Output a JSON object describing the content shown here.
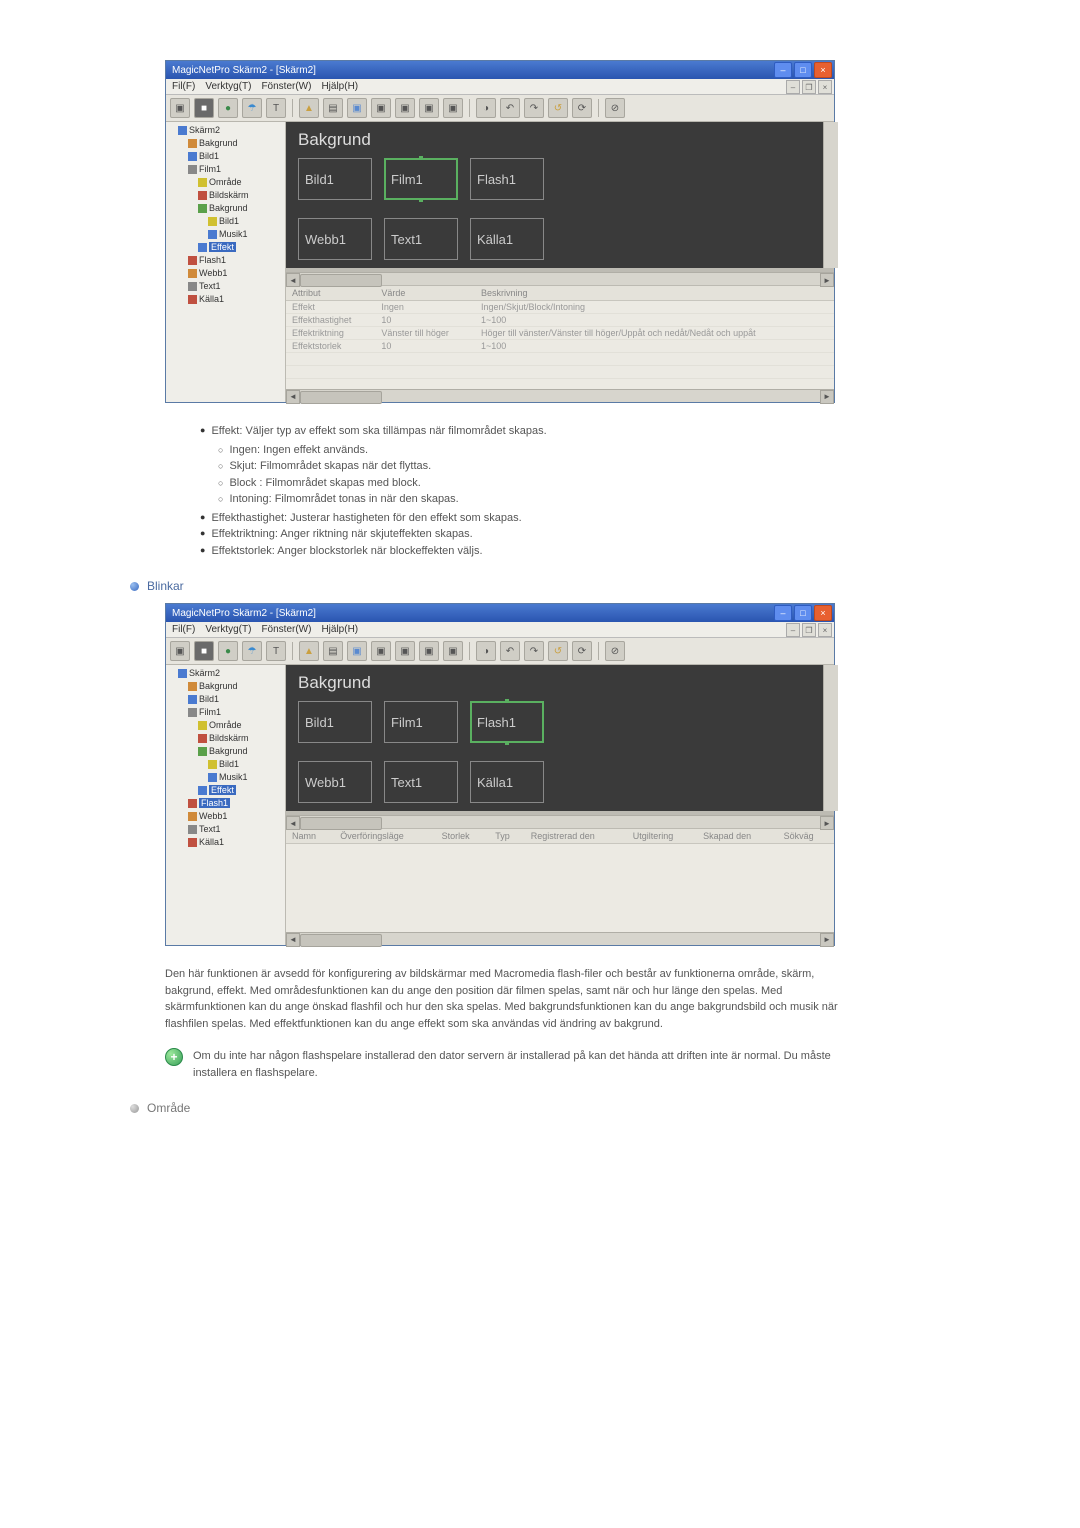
{
  "app": {
    "title": "MagicNetPro Skärm2 - [Skärm2]",
    "menus": [
      "Fil(F)",
      "Verktyg(T)",
      "Fönster(W)",
      "Hjälp(H)"
    ]
  },
  "tree": {
    "root": "Skärm2",
    "items": [
      {
        "label": "Bakgrund",
        "icon": "orange"
      },
      {
        "label": "Bild1",
        "icon": "blue"
      },
      {
        "label": "Film1",
        "icon": "gray",
        "children": [
          {
            "label": "Område",
            "icon": "yell"
          },
          {
            "label": "Bildskärm",
            "icon": "red"
          },
          {
            "label": "Bakgrund",
            "icon": "green",
            "children": [
              {
                "label": "Bild1",
                "icon": "yell"
              },
              {
                "label": "Musik1",
                "icon": "blue"
              }
            ]
          },
          {
            "label": "Effekt",
            "icon": "blue",
            "sel": true
          }
        ]
      },
      {
        "label": "Flash1",
        "icon": "red"
      },
      {
        "label": "Webb1",
        "icon": "orange"
      },
      {
        "label": "Text1",
        "icon": "gray"
      },
      {
        "label": "Källa1",
        "icon": "red"
      }
    ]
  },
  "tree2_sel": "Flash1",
  "stage": {
    "title": "Bakgrund",
    "boxesA": [
      "Bild1",
      "Film1",
      "Flash1",
      "Webb1",
      "Text1",
      "Källa1"
    ],
    "hlA": 1,
    "hlB": 2
  },
  "props1": {
    "cols": [
      "Attribut",
      "Värde",
      "Beskrivning"
    ],
    "rows": [
      [
        "Effekt",
        "Ingen",
        "Ingen/Skjut/Block/Intoning"
      ],
      [
        "Effekthastighet",
        "10",
        "1~100"
      ],
      [
        "Effektriktning",
        "Vänster till höger",
        "Höger till vänster/Vänster till höger/Uppåt och nedåt/Nedåt och uppåt"
      ],
      [
        "Effektstorlek",
        "10",
        "1~100"
      ]
    ]
  },
  "props2": {
    "cols": [
      "Namn",
      "Överföringsläge",
      "Storlek",
      "Typ",
      "Registrerad den",
      "Utgiltering",
      "Skapad den",
      "Sökväg"
    ]
  },
  "doc": {
    "bullets": [
      {
        "t": "Effekt: Väljer typ av effekt som ska tillämpas när filmområdet skapas.",
        "sub": [
          "Ingen: Ingen effekt används.",
          "Skjut: Filmområdet skapas när det flyttas.",
          "Block : Filmområdet skapas med block.",
          "Intoning: Filmområdet tonas in när den skapas."
        ]
      },
      {
        "t": "Effekthastighet: Justerar hastigheten för den effekt som skapas."
      },
      {
        "t": "Effektriktning: Anger riktning när skjuteffekten skapas."
      },
      {
        "t": "Effektstorlek: Anger blockstorlek när blockeffekten väljs."
      }
    ],
    "section_blinkar": "Blinkar",
    "para_flash": "Den här funktionen är avsedd för konfigurering av bildskärmar med Macromedia flash-filer och består av funktionerna område, skärm, bakgrund, effekt. Med områdesfunktionen kan du ange den position där filmen spelas, samt när och hur länge den spelas. Med skärmfunktionen kan du ange önskad flashfil och hur den ska spelas. Med bakgrundsfunktionen kan du ange bakgrundsbild och musik när flashfilen spelas. Med effektfunktionen kan du ange effekt som ska användas vid ändring av bakgrund.",
    "note_flash": "Om du inte har någon flashspelare installerad den dator servern är installerad på kan det hända att driften inte är normal. Du måste installera en flashspelare.",
    "section_omrade": "Område"
  },
  "icons": {
    "min": "–",
    "max": "□",
    "close": "×",
    "tb": [
      "▣",
      "■",
      "●",
      "☂",
      "T",
      "▲",
      "▤",
      "▣",
      "▣",
      "▣",
      "▣",
      "▣",
      "|",
      "◑",
      "↶",
      "↷",
      "↺",
      "⟳",
      "|",
      "⊘"
    ]
  }
}
